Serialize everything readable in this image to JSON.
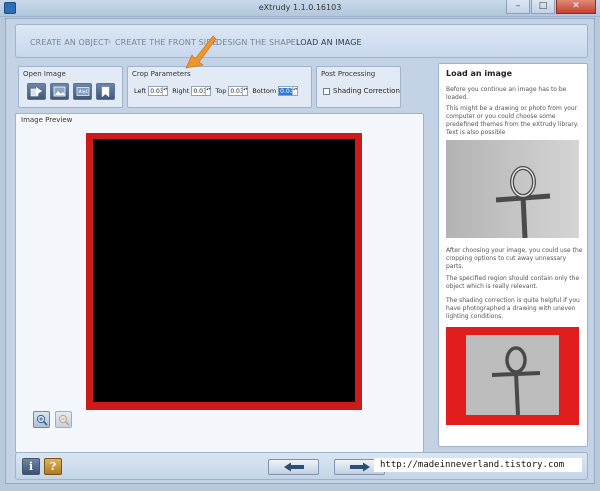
{
  "window": {
    "title": "eXtrudy 1.1.0.16103",
    "minimize_glyph": "–",
    "maximize_glyph": "□",
    "close_glyph": "✕"
  },
  "breadcrumb": {
    "steps": [
      {
        "label": "CREATE AN OBJECT"
      },
      {
        "label": "CREATE THE FRONT SIDE"
      },
      {
        "label": "DESIGN THE SHAPE"
      },
      {
        "label": "LOAD AN IMAGE"
      }
    ],
    "separator": "›",
    "active_index": 3
  },
  "open_image": {
    "title": "Open Image",
    "buttons": [
      {
        "icon": "open-file-icon"
      },
      {
        "icon": "image-library-icon"
      },
      {
        "icon": "text-abc-icon"
      },
      {
        "icon": "bookmark-icon"
      }
    ]
  },
  "crop": {
    "title": "Crop Parameters",
    "left_label": "Left",
    "left_value": "0.03",
    "right_label": "Right",
    "right_value": "0.03",
    "top_label": "Top",
    "top_value": "0.03",
    "bottom_label": "Bottom",
    "bottom_value": "0.03"
  },
  "post": {
    "title": "Post Processing",
    "shading_label": "Shading Correction",
    "shading_checked": false
  },
  "preview": {
    "title": "Image Preview",
    "zoom_in_icon": "zoom-in-icon",
    "zoom_out_icon": "zoom-out-icon"
  },
  "help": {
    "title": "Load an image",
    "p1": "Before you continue an image has to be loaded.",
    "p2": "This might be a drawing or photo from your computer or you could choose some predefined themes from the eXtrudy library. Text is also possible",
    "p3": "After choosing your image, you could use the cropping options to cut away unnessary parts.",
    "p4": "The specified region should contain only the object which is really relevant.",
    "p5": "The shading correction is quite helpful if you have photographed a drawing with uneven lighting conditions."
  },
  "footer": {
    "info_label": "i",
    "help_label": "?",
    "back_icon": "arrow-left-icon",
    "next_icon": "arrow-right-icon",
    "watermark": "http://madeinneverland.tistory.com"
  },
  "colors": {
    "accent": "#cc1b1b",
    "annotation_arrow": "#f0962a",
    "selection": "#3078d8"
  }
}
